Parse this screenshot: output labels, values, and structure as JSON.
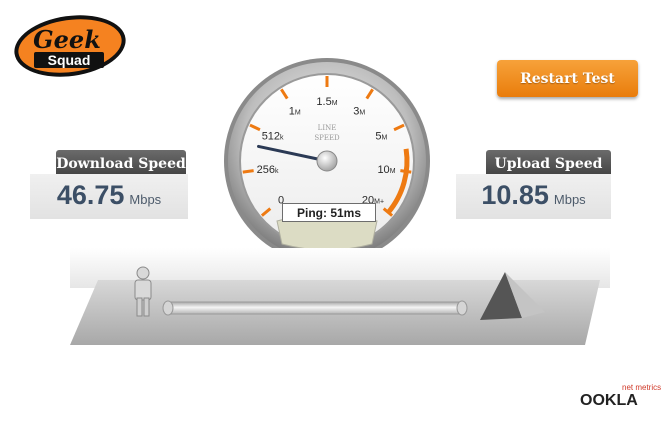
{
  "logo": {
    "line1": "Geek",
    "line2": "Squad"
  },
  "restart_button": {
    "label": "Restart Test"
  },
  "download": {
    "title": "Download Speed",
    "value": "46.75",
    "unit": "Mbps"
  },
  "upload": {
    "title": "Upload Speed",
    "value": "10.85",
    "unit": "Mbps"
  },
  "gauge": {
    "brand_line1": "LINE",
    "brand_line2": "SPEED",
    "ticks": [
      {
        "label": "0",
        "suffix": ""
      },
      {
        "label": "256",
        "suffix": "k"
      },
      {
        "label": "512",
        "suffix": "k"
      },
      {
        "label": "1",
        "suffix": "M"
      },
      {
        "label": "1.5",
        "suffix": "M"
      },
      {
        "label": "3",
        "suffix": "M"
      },
      {
        "label": "5",
        "suffix": "M"
      },
      {
        "label": "10",
        "suffix": "M"
      },
      {
        "label": "20",
        "suffix": "M+"
      }
    ],
    "needle_fraction": 0.2,
    "accent_color": "#ee7a12",
    "ping_label": "Ping: 51ms"
  },
  "footer": {
    "brand_small": "net metrics",
    "brand_large": "OOKLA"
  }
}
